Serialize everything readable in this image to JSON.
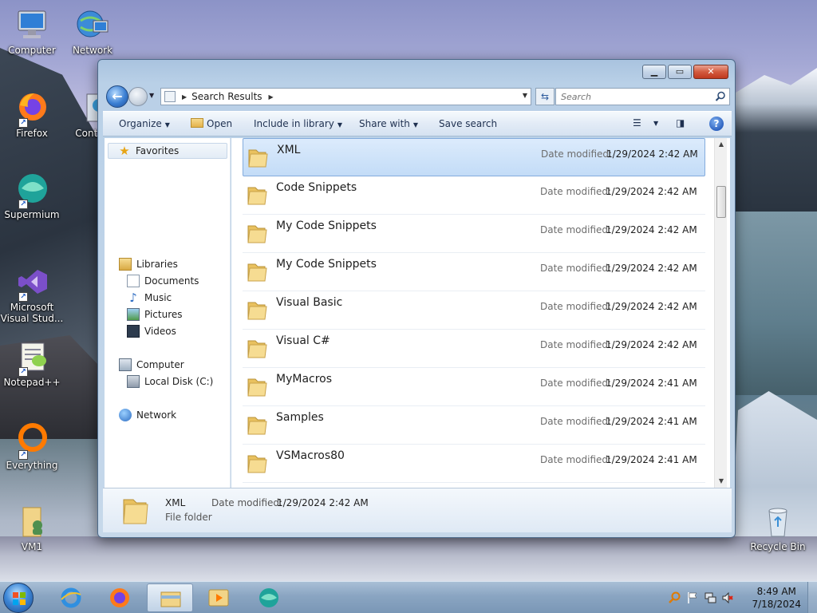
{
  "desktop": {
    "icons": [
      {
        "label": "Computer"
      },
      {
        "label": "Network"
      },
      {
        "label": "Firefox"
      },
      {
        "label": "Control"
      },
      {
        "label": "Supermium"
      },
      {
        "label": "Microsoft\nVisual Stud..."
      },
      {
        "label": "Notepad++"
      },
      {
        "label": "Everything"
      },
      {
        "label": "VM1"
      },
      {
        "label": "Recycle Bin"
      }
    ]
  },
  "window": {
    "address": {
      "crumb": "Search Results"
    },
    "search": {
      "placeholder": "Search"
    },
    "commands": {
      "organize": "Organize",
      "open": "Open",
      "include_in_library": "Include in library",
      "share_with": "Share with",
      "save_search": "Save search"
    },
    "nav": {
      "favorites": "Favorites",
      "libraries": "Libraries",
      "documents": "Documents",
      "music": "Music",
      "pictures": "Pictures",
      "videos": "Videos",
      "computer": "Computer",
      "local_disk": "Local Disk (C:)",
      "network": "Network"
    },
    "date_label": "Date modified:",
    "files": [
      {
        "name": "XML",
        "date": "1/29/2024 2:42 AM"
      },
      {
        "name": "Code Snippets",
        "date": "1/29/2024 2:42 AM"
      },
      {
        "name": "My Code Snippets",
        "date": "1/29/2024 2:42 AM"
      },
      {
        "name": "My Code Snippets",
        "date": "1/29/2024 2:42 AM"
      },
      {
        "name": "Visual Basic",
        "date": "1/29/2024 2:42 AM"
      },
      {
        "name": "Visual C#",
        "date": "1/29/2024 2:42 AM"
      },
      {
        "name": "MyMacros",
        "date": "1/29/2024 2:41 AM"
      },
      {
        "name": "Samples",
        "date": "1/29/2024 2:41 AM"
      },
      {
        "name": "VSMacros80",
        "date": "1/29/2024 2:41 AM"
      }
    ],
    "details": {
      "name": "XML",
      "date_label": "Date modified:",
      "date": "1/29/2024 2:42 AM",
      "type": "File folder"
    }
  },
  "taskbar": {
    "clock_time": "8:49 AM",
    "clock_date": "7/18/2024"
  },
  "colors": {
    "selection": "#c3dcf7",
    "taskbar": "#8aa5c2",
    "accent": "#3b7fd3"
  }
}
